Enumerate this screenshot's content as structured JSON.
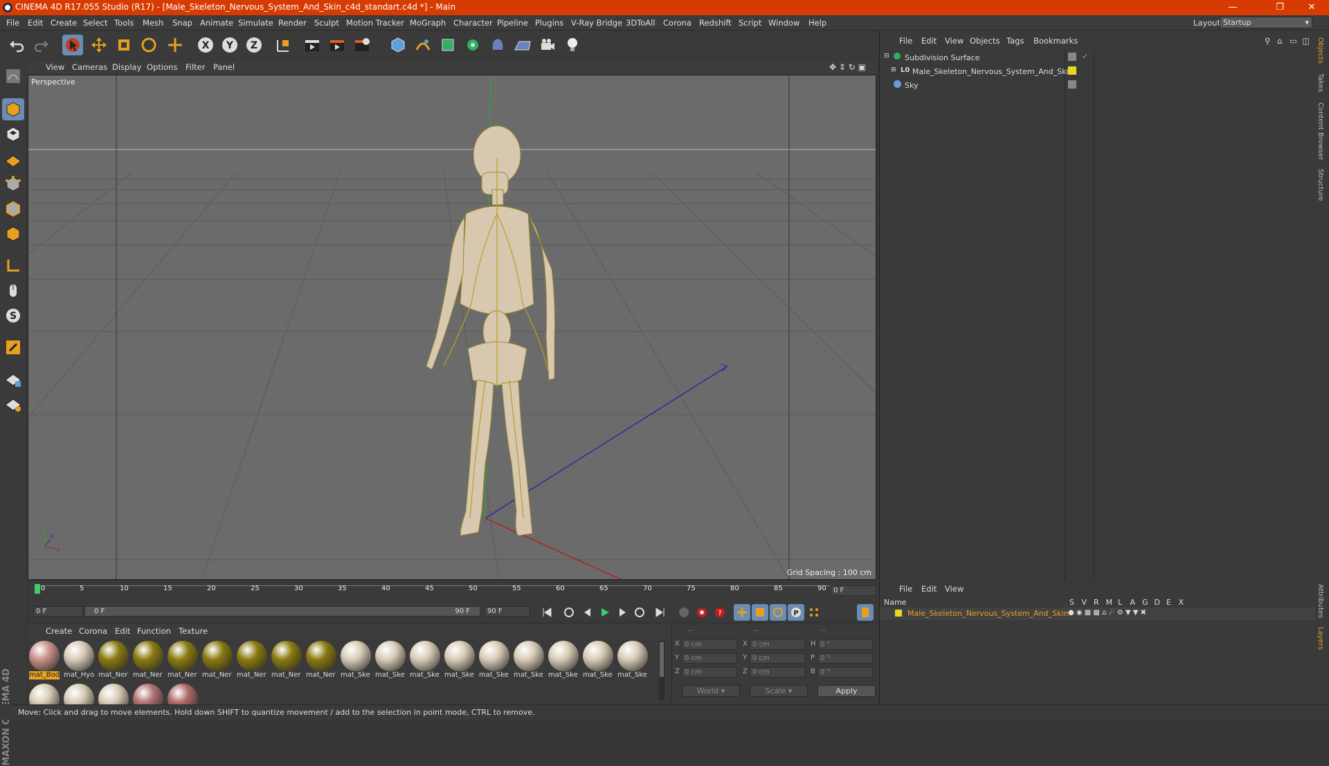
{
  "window": {
    "title": "CINEMA 4D R17.055 Studio (R17) - [Male_Skeleton_Nervous_System_And_Skin_c4d_standart.c4d *] - Main"
  },
  "menus": [
    "File",
    "Edit",
    "Create",
    "Select",
    "Tools",
    "Mesh",
    "Snap",
    "Animate",
    "Simulate",
    "Render",
    "Sculpt",
    "Motion Tracker",
    "MoGraph",
    "Character",
    "Pipeline",
    "Plugins",
    "V-Ray Bridge",
    "3DToAll",
    "Corona",
    "Redshift",
    "Script",
    "Window",
    "Help"
  ],
  "layout": {
    "label": "Layout:",
    "value": "Startup"
  },
  "viewport": {
    "menus": [
      "View",
      "Cameras",
      "Display",
      "Options",
      "Filter",
      "Panel"
    ],
    "camera": "Perspective",
    "grid_spacing": "Grid Spacing : 100 cm"
  },
  "timeline": {
    "ticks": [
      "0",
      "5",
      "10",
      "15",
      "20",
      "25",
      "30",
      "35",
      "40",
      "45",
      "50",
      "55",
      "60",
      "65",
      "70",
      "75",
      "80",
      "85",
      "90"
    ],
    "current": "0 F",
    "start": "0 F",
    "range_start": "0 F",
    "range_end": "90 F",
    "end": "90 F"
  },
  "materials": {
    "menus": [
      "Create",
      "Corona",
      "Edit",
      "Function",
      "Texture"
    ],
    "items": [
      {
        "name": "mat_Bod",
        "color": "#c89088"
      },
      {
        "name": "mat_Hyo",
        "color": "#d8cbb6"
      },
      {
        "name": "mat_Ner",
        "color": "#8a7a10"
      },
      {
        "name": "mat_Ner",
        "color": "#8a7a10"
      },
      {
        "name": "mat_Ner",
        "color": "#8a7a10"
      },
      {
        "name": "mat_Ner",
        "color": "#8a7a10"
      },
      {
        "name": "mat_Ner",
        "color": "#8a7a10"
      },
      {
        "name": "mat_Ner",
        "color": "#8a7a10"
      },
      {
        "name": "mat_Ner",
        "color": "#8a7a10"
      },
      {
        "name": "mat_Ske",
        "color": "#d8cbb6"
      },
      {
        "name": "mat_Ske",
        "color": "#d8cbb6"
      },
      {
        "name": "mat_Ske",
        "color": "#d8cbb6"
      },
      {
        "name": "mat_Ske",
        "color": "#d8cbb6"
      },
      {
        "name": "mat_Ske",
        "color": "#d8cbb6"
      },
      {
        "name": "mat_Ske",
        "color": "#d8cbb6"
      },
      {
        "name": "mat_Ske",
        "color": "#d8cbb6"
      },
      {
        "name": "mat_Ske",
        "color": "#d8cbb6"
      },
      {
        "name": "mat_Ske",
        "color": "#d8cbb6"
      }
    ],
    "row2": [
      "#d8cbb6",
      "#d8cbb6",
      "#d8cbb6",
      "#b07070",
      "#b06868"
    ]
  },
  "coords": {
    "headers": [
      "--",
      "--",
      "--"
    ],
    "rows": [
      {
        "a": "X",
        "av": "0 cm",
        "b": "X",
        "bv": "0 cm",
        "c": "H",
        "cv": "0 °"
      },
      {
        "a": "Y",
        "av": "0 cm",
        "b": "Y",
        "bv": "0 cm",
        "c": "P",
        "cv": "0 °"
      },
      {
        "a": "Z",
        "av": "0 cm",
        "b": "Z",
        "bv": "0 cm",
        "c": "B",
        "cv": "0 °"
      }
    ],
    "world": "World",
    "scale": "Scale",
    "apply": "Apply"
  },
  "objects": {
    "menus": [
      "File",
      "Edit",
      "View",
      "Objects",
      "Tags",
      "Bookmarks"
    ],
    "items": [
      {
        "name": "Subdivision Surface"
      },
      {
        "name": "Male_Skeleton_Nervous_System_And_Skin"
      },
      {
        "name": "Sky"
      }
    ]
  },
  "layers": {
    "menus": [
      "File",
      "Edit",
      "View"
    ],
    "header_name": "Name",
    "cols": [
      "S",
      "V",
      "R",
      "M",
      "L",
      "A",
      "G",
      "D",
      "E",
      "X"
    ],
    "item": "Male_Skeleton_Nervous_System_And_Skin"
  },
  "side_tabs": [
    "Objects",
    "Takes",
    "Content Browser",
    "Structure"
  ],
  "side_tabs2": [
    "Attributes",
    "Layers"
  ],
  "brand": "MAXON CINEMA 4D",
  "status": "Move: Click and drag to move elements. Hold down SHIFT to quantize movement / add to the selection in point mode, CTRL to remove."
}
